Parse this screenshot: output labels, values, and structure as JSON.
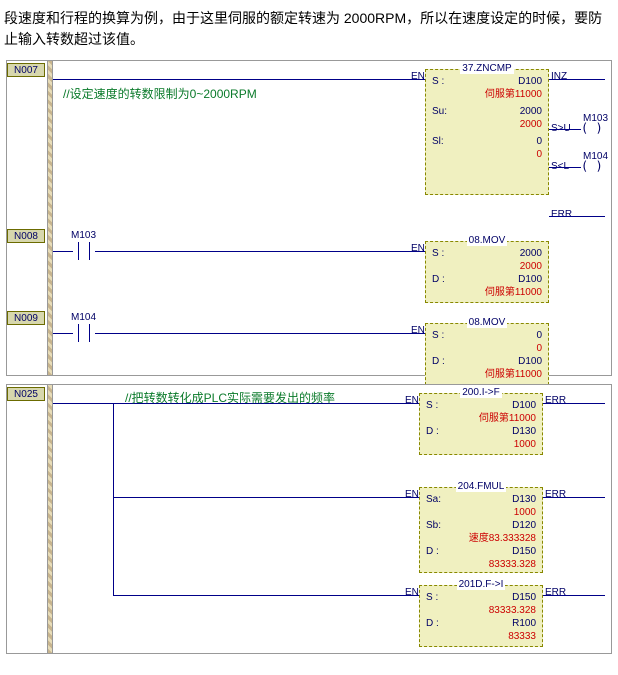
{
  "desc": "段速度和行程的换算为例，由于这里伺服的额定转速为 2000RPM，所以在速度设定的时候，要防止输入转数超过该值。",
  "rung": {
    "n007": "N007",
    "n008": "N008",
    "n009": "N009",
    "n025": "N025"
  },
  "comments": {
    "c1": "//设定速度的转数限制为0~2000RPM",
    "c2": "//把转数转化成PLC实际需要发出的频率"
  },
  "contacts": {
    "m103": "M103",
    "m104": "M104"
  },
  "coils": {
    "m103": "M103",
    "m104": "M104",
    "paren": "( )"
  },
  "pins": {
    "en": "EN",
    "inz": "INZ",
    "sgu": "S>U",
    "slt": "S<L",
    "err": "ERR"
  },
  "blocks": {
    "zncmp": {
      "title": "37.ZNCMP",
      "s_k": "S :",
      "s_v": "D100",
      "s_r": "伺服第11000",
      "su_k": "Su:",
      "su_v": "2000",
      "su_r": "2000",
      "sl_k": "Sl:",
      "sl_v": "0",
      "sl_r": "0"
    },
    "mov1": {
      "title": "08.MOV",
      "s_k": "S :",
      "s_v": "2000",
      "s_r": "2000",
      "d_k": "D :",
      "d_v": "D100",
      "d_r": "伺服第11000"
    },
    "mov2": {
      "title": "08.MOV",
      "s_k": "S :",
      "s_v": "0",
      "s_r": "0",
      "d_k": "D :",
      "d_v": "D100",
      "d_r": "伺服第11000"
    },
    "itof": {
      "title": "200.I->F",
      "s_k": "S :",
      "s_v": "D100",
      "s_r": "伺服第11000",
      "d_k": "D :",
      "d_v": "D130",
      "d_r": "1000"
    },
    "fmul": {
      "title": "204.FMUL",
      "sa_k": "Sa:",
      "sa_v": "D130",
      "sa_r": "1000",
      "sb_k": "Sb:",
      "sb_v": "D120",
      "sb_r": "速度83.333328",
      "d_k": "D :",
      "d_v": "D150",
      "d_r": "83333.328"
    },
    "ftoi": {
      "title": "201D.F->I",
      "s_k": "S :",
      "s_v": "D150",
      "s_r": "83333.328",
      "d_k": "D :",
      "d_v": "R100",
      "d_r": "83333"
    }
  }
}
